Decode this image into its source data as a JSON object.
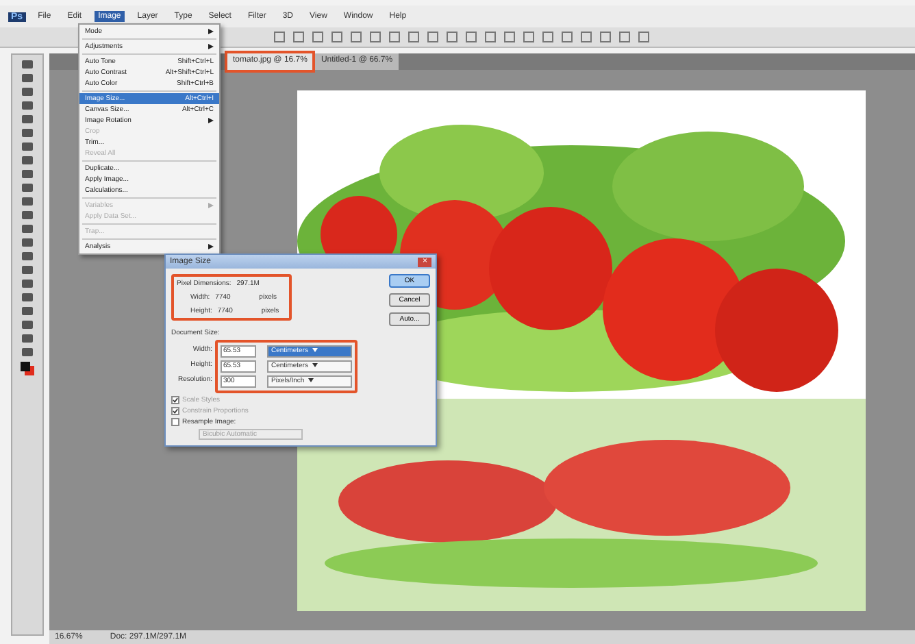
{
  "app_logo": "Ps",
  "menu_bar": [
    {
      "label": "File",
      "selected": false
    },
    {
      "label": "Edit",
      "selected": false
    },
    {
      "label": "Image",
      "selected": true
    },
    {
      "label": "Layer",
      "selected": false
    },
    {
      "label": "Type",
      "selected": false
    },
    {
      "label": "Select",
      "selected": false
    },
    {
      "label": "Filter",
      "selected": false
    },
    {
      "label": "3D",
      "selected": false
    },
    {
      "label": "View",
      "selected": false
    },
    {
      "label": "Window",
      "selected": false
    },
    {
      "label": "Help",
      "selected": false
    }
  ],
  "tabs": [
    {
      "label": "tomato.jpg @ 16.7%",
      "selected": true,
      "highlighted": true
    },
    {
      "label": "Untitled-1 @ 66.7%",
      "selected": false,
      "highlighted": false
    }
  ],
  "image_menu": [
    {
      "kind": "item",
      "label": "Mode",
      "submenu": true,
      "disabled": false,
      "selected": false
    },
    {
      "kind": "separator"
    },
    {
      "kind": "item",
      "label": "Adjustments",
      "submenu": true,
      "disabled": false,
      "selected": false
    },
    {
      "kind": "separator"
    },
    {
      "kind": "item",
      "label": "Auto Tone",
      "shortcut": "Shift+Ctrl+L",
      "submenu": false,
      "disabled": false,
      "selected": false
    },
    {
      "kind": "item",
      "label": "Auto Contrast",
      "shortcut": "Alt+Shift+Ctrl+L",
      "submenu": false,
      "disabled": false,
      "selected": false
    },
    {
      "kind": "item",
      "label": "Auto Color",
      "shortcut": "Shift+Ctrl+B",
      "submenu": false,
      "disabled": false,
      "selected": false
    },
    {
      "kind": "separator"
    },
    {
      "kind": "item",
      "label": "Image Size...",
      "shortcut": "Alt+Ctrl+I",
      "submenu": false,
      "disabled": false,
      "selected": true
    },
    {
      "kind": "item",
      "label": "Canvas Size...",
      "shortcut": "Alt+Ctrl+C",
      "submenu": false,
      "disabled": false,
      "selected": false
    },
    {
      "kind": "item",
      "label": "Image Rotation",
      "submenu": true,
      "disabled": false,
      "selected": false
    },
    {
      "kind": "item",
      "label": "Crop",
      "submenu": false,
      "disabled": true,
      "selected": false
    },
    {
      "kind": "item",
      "label": "Trim...",
      "submenu": false,
      "disabled": false,
      "selected": false
    },
    {
      "kind": "item",
      "label": "Reveal All",
      "submenu": false,
      "disabled": true,
      "selected": false
    },
    {
      "kind": "separator"
    },
    {
      "kind": "item",
      "label": "Duplicate...",
      "submenu": false,
      "disabled": false,
      "selected": false
    },
    {
      "kind": "item",
      "label": "Apply Image...",
      "submenu": false,
      "disabled": false,
      "selected": false
    },
    {
      "kind": "item",
      "label": "Calculations...",
      "submenu": false,
      "disabled": false,
      "selected": false
    },
    {
      "kind": "separator"
    },
    {
      "kind": "item",
      "label": "Variables",
      "submenu": true,
      "disabled": true,
      "selected": false
    },
    {
      "kind": "item",
      "label": "Apply Data Set...",
      "submenu": false,
      "disabled": true,
      "selected": false
    },
    {
      "kind": "separator"
    },
    {
      "kind": "item",
      "label": "Trap...",
      "submenu": false,
      "disabled": true,
      "selected": false
    },
    {
      "kind": "separator"
    },
    {
      "kind": "item",
      "label": "Analysis",
      "submenu": true,
      "disabled": false,
      "selected": false
    }
  ],
  "dialog": {
    "title": "Image Size",
    "close": "×",
    "pixel_dimensions": {
      "label": "Pixel Dimensions:",
      "value": "297.1M",
      "rows": [
        {
          "label": "Width:",
          "value": "7740",
          "unit": "pixels"
        },
        {
          "label": "Height:",
          "value": "7740",
          "unit": "pixels"
        }
      ]
    },
    "document_size": {
      "label": "Document Size:",
      "rows": [
        {
          "label": "Width:",
          "value": "65.53",
          "unit": "Centimeters",
          "selected": true
        },
        {
          "label": "Height:",
          "value": "65.53",
          "unit": "Centimeters",
          "selected": false
        },
        {
          "label": "Resolution:",
          "value": "300",
          "unit": "Pixels/Inch",
          "selected": false
        }
      ]
    },
    "options": [
      {
        "label": "Scale Styles",
        "checked": true,
        "disabled": true
      },
      {
        "label": "Constrain Proportions",
        "checked": true,
        "disabled": true
      },
      {
        "label": "Resample Image:",
        "checked": false,
        "disabled": false
      }
    ],
    "resample_method": "Bicubic Automatic",
    "buttons": [
      {
        "label": "OK",
        "selected": true
      },
      {
        "label": "Cancel",
        "selected": false
      },
      {
        "label": "Auto...",
        "selected": false
      }
    ]
  },
  "status_bar": {
    "zoom": "16.67%",
    "doc": "Doc: 297.1M/297.1M"
  }
}
